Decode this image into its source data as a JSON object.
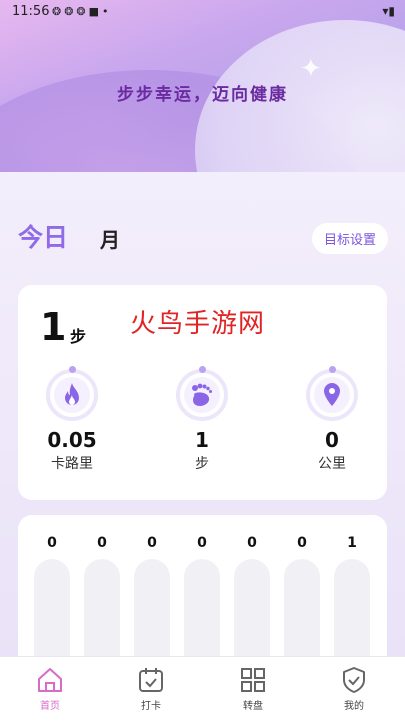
{
  "status_bar": {
    "time": "11:56"
  },
  "header": {
    "slogan": "步步幸运，迈向健康"
  },
  "tabs": {
    "today": "今日",
    "month": "月",
    "goal_settings": "目标设置"
  },
  "summary": {
    "steps_value": "1",
    "steps_unit": "步",
    "watermark": "火鸟手游网",
    "stats": [
      {
        "value": "0.05",
        "label": "卡路里",
        "icon": "flame-icon"
      },
      {
        "value": "1",
        "label": "步",
        "icon": "footprint-icon"
      },
      {
        "value": "0",
        "label": "公里",
        "icon": "location-pin-icon"
      }
    ]
  },
  "weekly": {
    "values": [
      "0",
      "0",
      "0",
      "0",
      "0",
      "0",
      "1"
    ]
  },
  "bottom_nav": [
    {
      "label": "首页",
      "icon": "home-icon",
      "active": true
    },
    {
      "label": "打卡",
      "icon": "calendar-check-icon",
      "active": false
    },
    {
      "label": "转盘",
      "icon": "grid-icon",
      "active": false
    },
    {
      "label": "我的",
      "icon": "shield-check-icon",
      "active": false
    }
  ],
  "colors": {
    "accent": "#8f6be8",
    "active_nav": "#d86bc8",
    "watermark": "#e02424"
  }
}
